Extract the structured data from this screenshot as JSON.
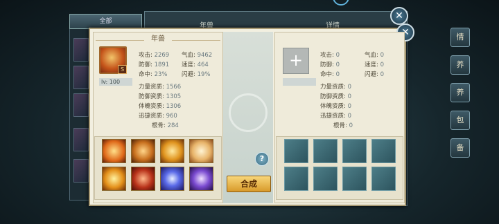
{
  "background": {
    "tab_all": "全部",
    "title": "年兽",
    "detail_tab": "详情",
    "side_tabs": [
      "情",
      "养",
      "养",
      "包",
      "备"
    ]
  },
  "left_pet": {
    "name": "年兽",
    "level": "lv: 100",
    "badge": "S",
    "stats": [
      {
        "label": "攻击:",
        "value": "2269"
      },
      {
        "label": "气血:",
        "value": "9462"
      },
      {
        "label": "防御:",
        "value": "1891"
      },
      {
        "label": "速度:",
        "value": "464"
      },
      {
        "label": "命中:",
        "value": "23%"
      },
      {
        "label": "闪避:",
        "value": "19%"
      }
    ],
    "aptitudes": [
      {
        "label": "力量资质:",
        "value": "1566"
      },
      {
        "label": "防御资质:",
        "value": "1305"
      },
      {
        "label": "体魄资质:",
        "value": "1306"
      },
      {
        "label": "迅捷资质:",
        "value": "960"
      },
      {
        "label": "根骨:",
        "value": "284"
      }
    ],
    "skills": [
      "phoenix-skill-icon",
      "armor-skill-icon",
      "beast-skill-icon",
      "tiger-skill-icon",
      "flame-skill-icon",
      "fist-skill-icon",
      "vortex-skill-icon",
      "lightning-skill-icon"
    ]
  },
  "right_pet": {
    "add_symbol": "+",
    "stats": [
      {
        "label": "攻击:",
        "value": "0"
      },
      {
        "label": "气血:",
        "value": "0"
      },
      {
        "label": "防御:",
        "value": "0"
      },
      {
        "label": "速度:",
        "value": "0"
      },
      {
        "label": "命中:",
        "value": "0"
      },
      {
        "label": "闪避:",
        "value": "0"
      }
    ],
    "aptitudes": [
      {
        "label": "力量资质:",
        "value": "0"
      },
      {
        "label": "防御资质:",
        "value": "0"
      },
      {
        "label": "体魄资质:",
        "value": "0"
      },
      {
        "label": "迅捷资质:",
        "value": "0"
      },
      {
        "label": "根骨:",
        "value": "0"
      }
    ]
  },
  "actions": {
    "synthesize": "合成",
    "help": "?",
    "close": "✕"
  }
}
